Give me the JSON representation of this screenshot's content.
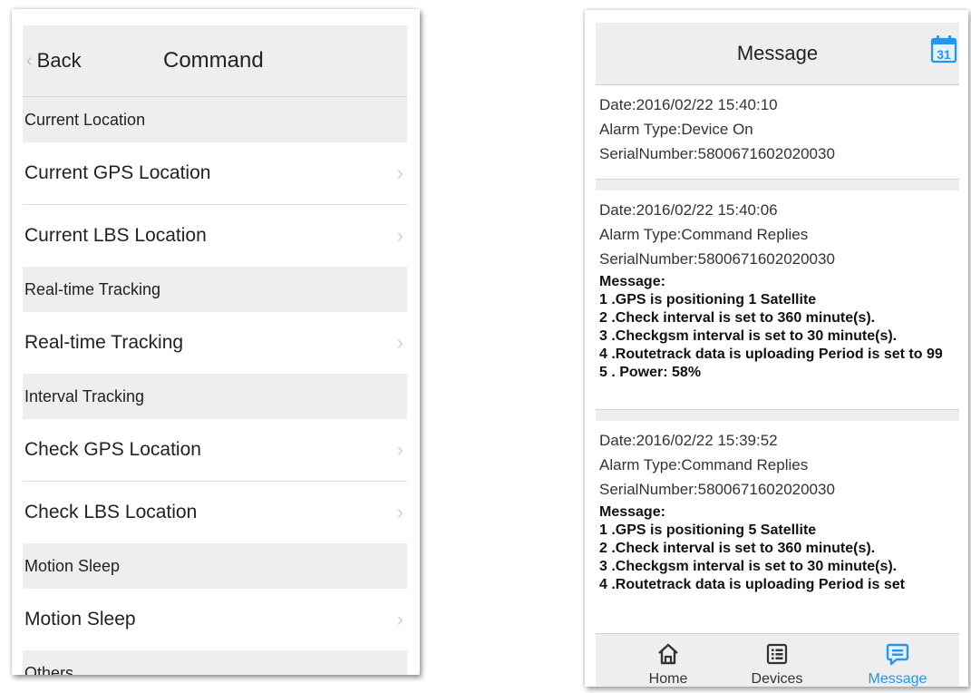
{
  "command_screen": {
    "back_label": "Back",
    "title": "Command",
    "sections": [
      {
        "header": "Current Location",
        "items": [
          "Current GPS Location",
          "Current LBS Location"
        ]
      },
      {
        "header": "Real-time Tracking",
        "items": [
          "Real-time Tracking"
        ]
      },
      {
        "header": "Interval Tracking",
        "items": [
          "Check GPS Location",
          "Check LBS Location"
        ]
      },
      {
        "header": "Motion Sleep",
        "items": [
          "Motion Sleep"
        ]
      },
      {
        "header": "Others",
        "items": []
      }
    ]
  },
  "message_screen": {
    "title": "Message",
    "calendar_day": "31",
    "messages": [
      {
        "date": "Date:2016/02/22 15:40:10",
        "alarm_type": "Alarm Type:Device On",
        "serial": "SerialNumber:5800671602020030",
        "message_label": "",
        "message_lines": []
      },
      {
        "date": "Date:2016/02/22 15:40:06",
        "alarm_type": "Alarm Type:Command Replies",
        "serial": "SerialNumber:5800671602020030",
        "message_label": "Message:",
        "message_lines": [
          "1 .GPS is positioning 1 Satellite",
          "2 .Check interval is set to 360 minute(s).",
          "3 .Checkgsm interval is set to 30 minute(s).",
          "4 .Routetrack data is uploading  Period is set to 99",
          "5 . Power: 58%"
        ]
      },
      {
        "date": "Date:2016/02/22 15:39:52",
        "alarm_type": "Alarm Type:Command Replies",
        "serial": "SerialNumber:5800671602020030",
        "message_label": "Message:",
        "message_lines": [
          "1 .GPS is positioning 5 Satellite",
          "2 .Check interval is set to 360 minute(s).",
          "3 .Checkgsm interval is set to 30 minute(s).",
          "4 .Routetrack data is uploading  Period is set"
        ]
      }
    ],
    "tabs": [
      {
        "label": "Home",
        "icon": "home-icon",
        "active": false
      },
      {
        "label": "Devices",
        "icon": "devices-list-icon",
        "active": false
      },
      {
        "label": "Message",
        "icon": "message-icon",
        "active": true
      }
    ]
  },
  "colors": {
    "accent": "#2196f3",
    "header_bg": "#eeeeee",
    "divider": "#dcdcdc",
    "chevron": "#d2d2d2"
  }
}
